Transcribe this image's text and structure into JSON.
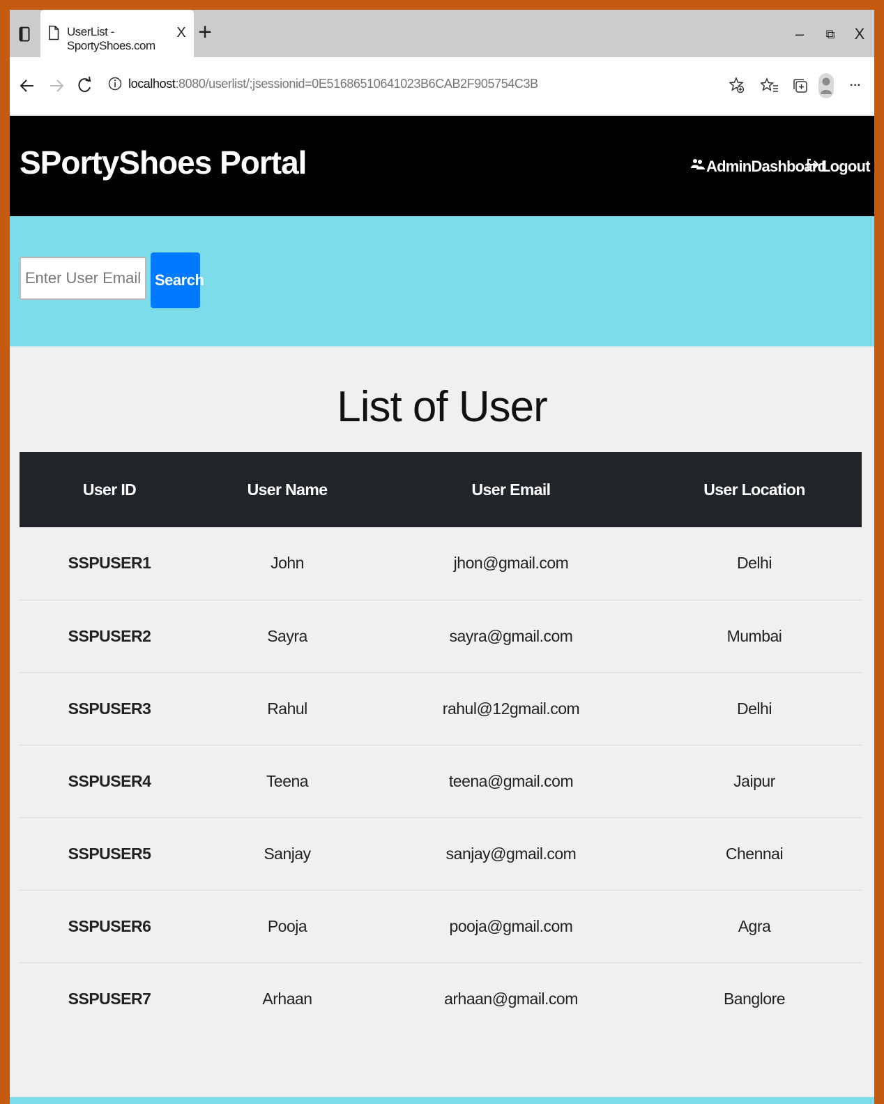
{
  "browser": {
    "tab_title": "UserList - SportyShoes.com",
    "tab_close": "X",
    "new_tab": "+",
    "window_controls": {
      "minimize": "–",
      "restore": "⧉",
      "close": "X"
    },
    "url_host": "localhost",
    "url_rest": ":8080/userlist/;jsessionid=0E51686510641023B6CAB2F905754C3B",
    "more": "···"
  },
  "navbar": {
    "brand": "SPortyShoes Portal",
    "admin_dashboard": "AdminDashboard",
    "logout": "Logout"
  },
  "search": {
    "placeholder": "Enter User Email",
    "button": "Search"
  },
  "page_title": "List of User",
  "table": {
    "headers": [
      "User ID",
      "User Name",
      "User Email",
      "User Location"
    ],
    "rows": [
      [
        "SSPUSER1",
        "John",
        "jhon@gmail.com",
        "Delhi"
      ],
      [
        "SSPUSER2",
        "Sayra",
        "sayra@gmail.com",
        "Mumbai"
      ],
      [
        "SSPUSER3",
        "Rahul",
        "rahul@12gmail.com",
        "Delhi"
      ],
      [
        "SSPUSER4",
        "Teena",
        "teena@gmail.com",
        "Jaipur"
      ],
      [
        "SSPUSER5",
        "Sanjay",
        "sanjay@gmail.com",
        "Chennai"
      ],
      [
        "SSPUSER6",
        "Pooja",
        "pooja@gmail.com",
        "Agra"
      ],
      [
        "SSPUSER7",
        "Arhaan",
        "arhaan@gmail.com",
        "Banglore"
      ]
    ]
  },
  "colors": {
    "frame_border": "#c55a11",
    "navbar_bg": "#000000",
    "search_band_bg": "#7ddcea",
    "search_button_bg": "#007bff",
    "table_header_bg": "#212529"
  }
}
